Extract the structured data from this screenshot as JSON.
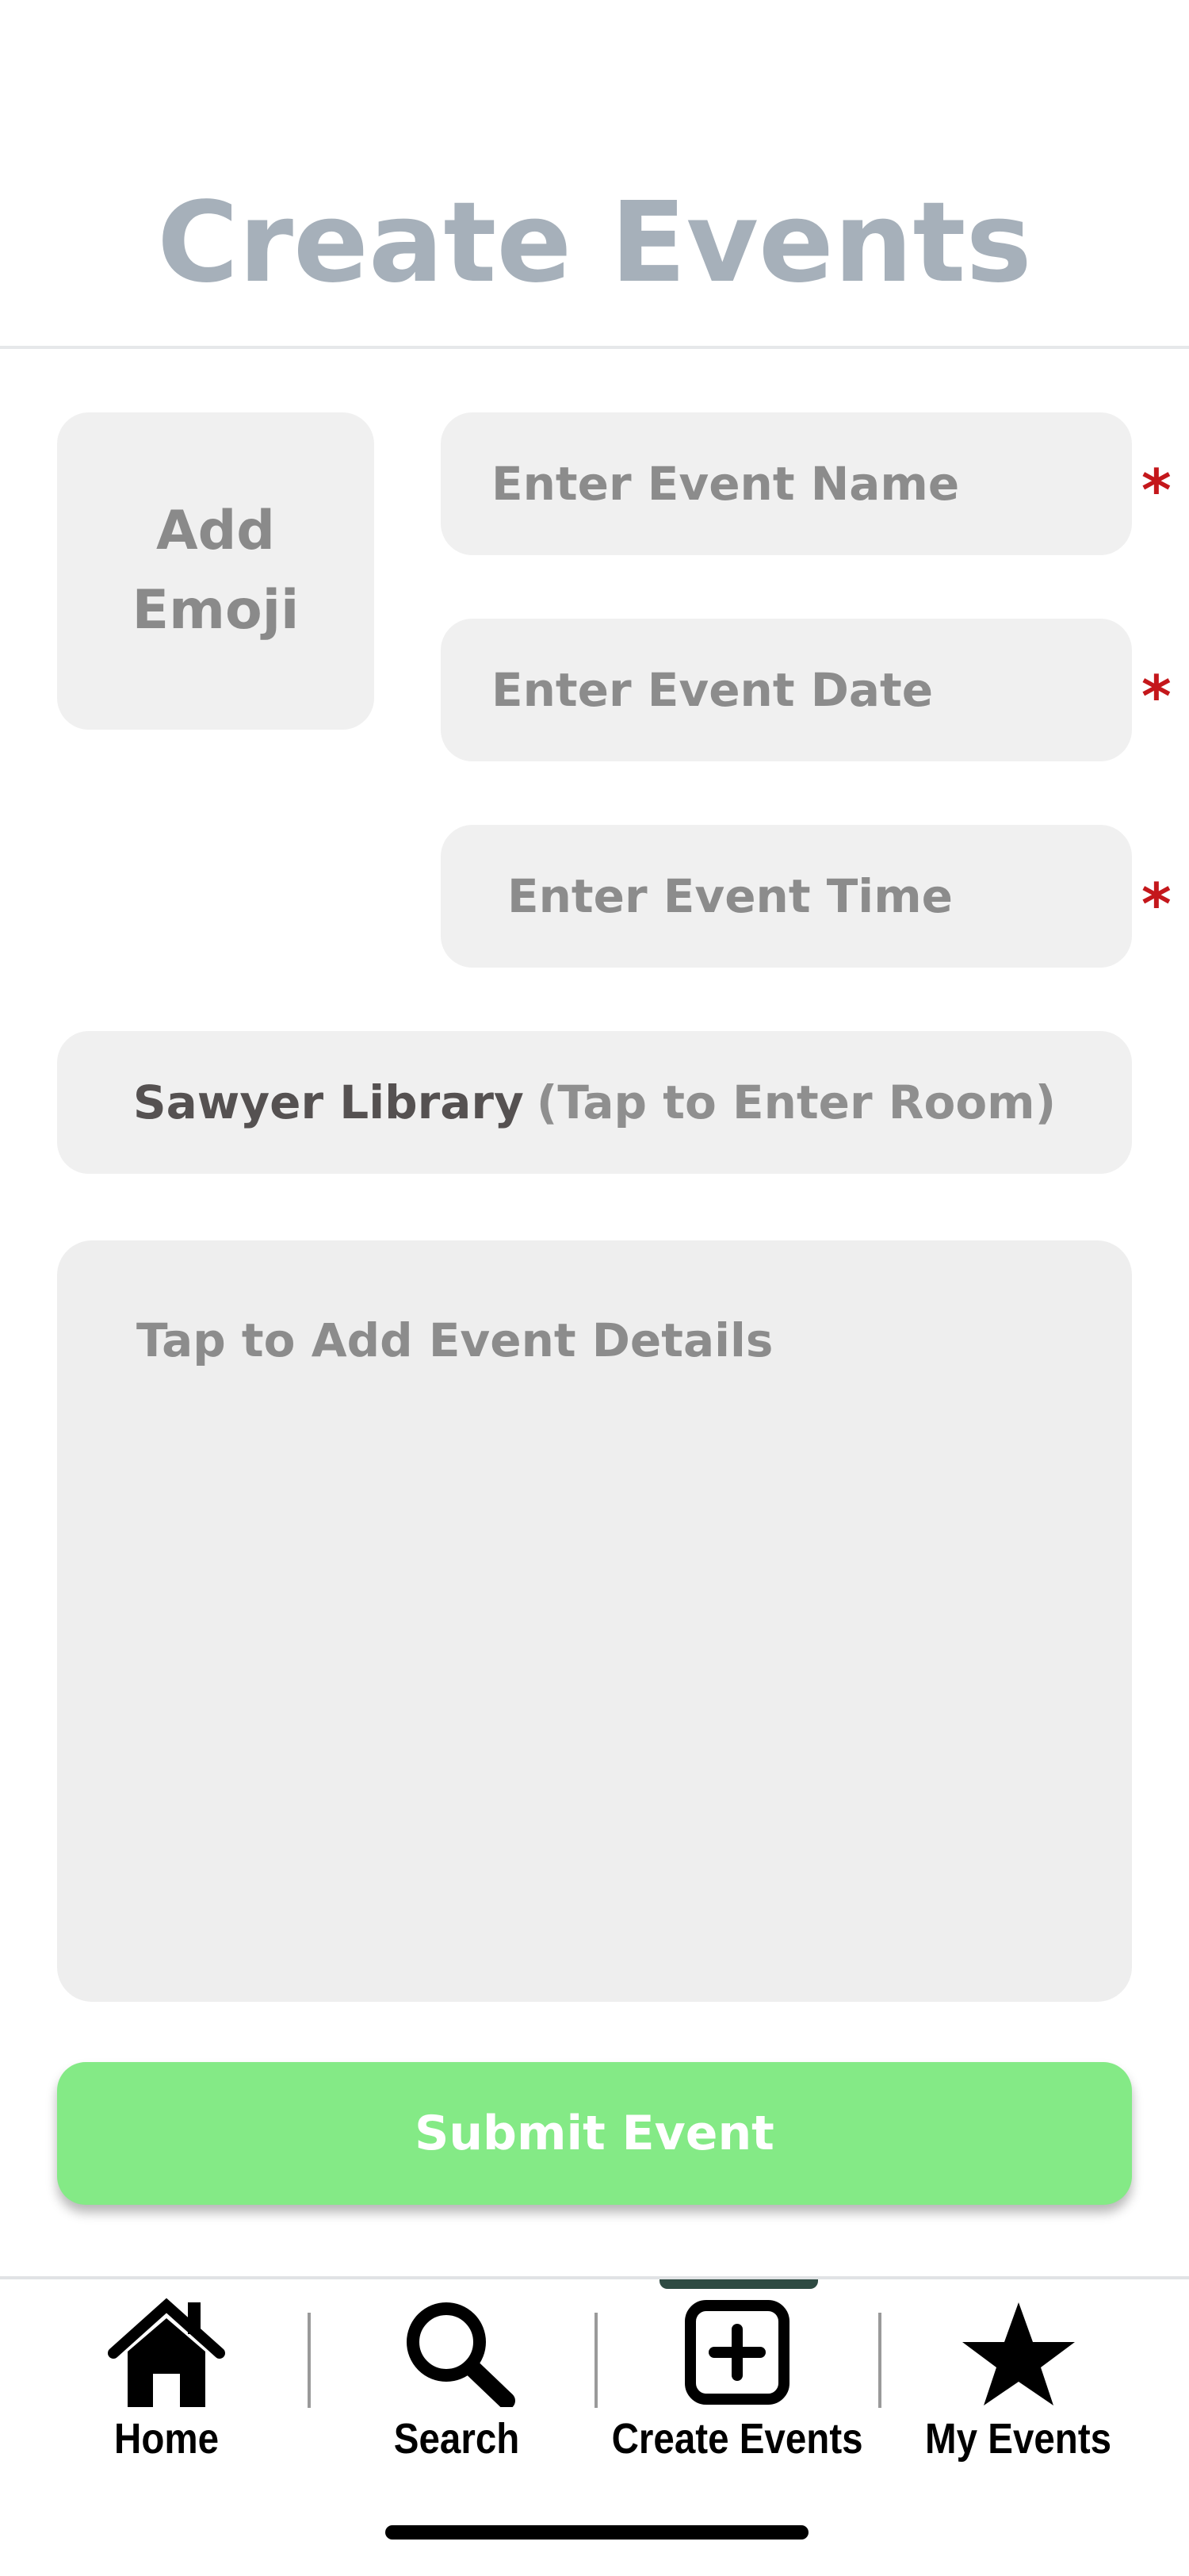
{
  "header": {
    "title": "Create Events"
  },
  "form": {
    "emoji_button": {
      "line1": "Add",
      "line2": "Emoji"
    },
    "event_name": {
      "placeholder": "Enter Event Name",
      "required_marker": "*"
    },
    "event_date": {
      "placeholder": "Enter Event Date",
      "required_marker": "*"
    },
    "event_time": {
      "placeholder": "Enter Event Time",
      "required_marker": "*"
    },
    "location": {
      "name": "Sawyer Library",
      "hint": "(Tap to Enter Room)"
    },
    "details": {
      "placeholder": "Tap to Add Event Details"
    },
    "submit_label": "Submit Event"
  },
  "tabbar": {
    "selected": "Create Events",
    "tabs": [
      {
        "label": "Home",
        "icon": "home-icon"
      },
      {
        "label": "Search",
        "icon": "search-icon"
      },
      {
        "label": "Create Events",
        "icon": "plus-square-icon"
      },
      {
        "label": "My Events",
        "icon": "star-icon"
      }
    ]
  },
  "colors": {
    "title": "#a6b0ba",
    "field_bg": "#f0f0f0",
    "required": "#c4171b",
    "submit_bg": "#84ea86",
    "tab_indicator": "#2e4a42"
  }
}
